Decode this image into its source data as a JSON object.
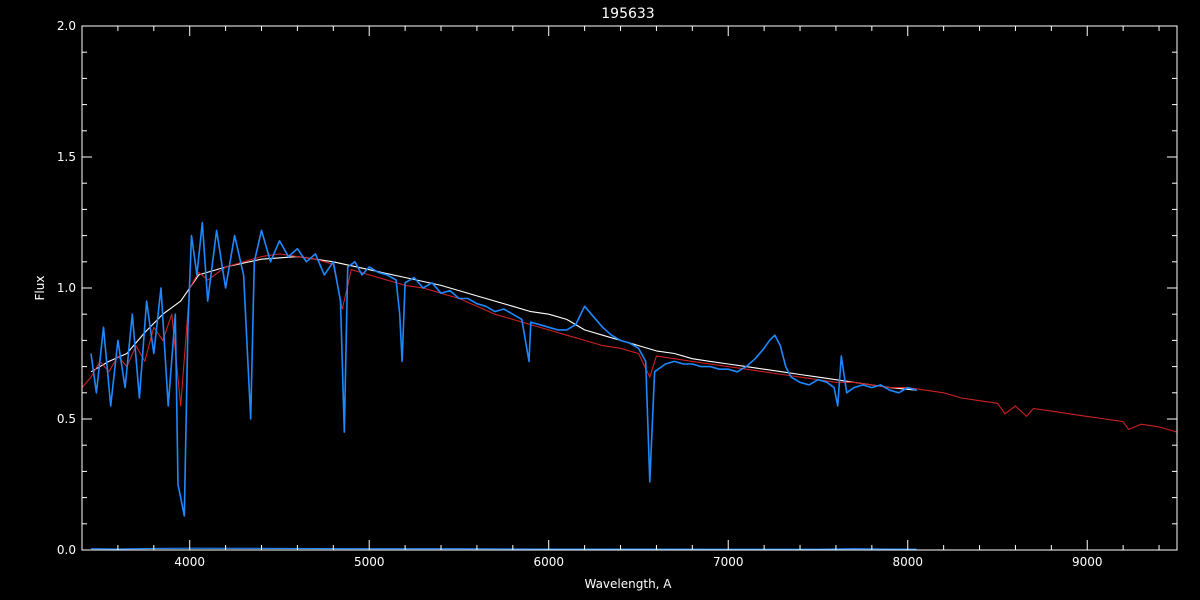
{
  "chart_data": {
    "type": "line",
    "title": "195633",
    "xlabel": "Wavelength, A",
    "ylabel": "Flux",
    "xlim": [
      3400,
      9500
    ],
    "ylim": [
      0,
      2.0
    ],
    "xticks": [
      4000,
      5000,
      6000,
      7000,
      8000,
      9000
    ],
    "xtick_labels": [
      "4000",
      "5000",
      "6000",
      "7000",
      "8000",
      "9000"
    ],
    "yticks": [
      0,
      0.5,
      1.0,
      1.5,
      2.0
    ],
    "ytick_labels": [
      "0.0",
      "0.5",
      "1.0",
      "1.5",
      "2.0"
    ],
    "grid": false,
    "background": "#000000",
    "series": [
      {
        "color": "#ffffff",
        "x": [
          3450,
          3550,
          3650,
          3750,
          3850,
          3950,
          4050,
          4200,
          4400,
          4600,
          4800,
          5000,
          5200,
          5400,
          5600,
          5800,
          5900,
          6000,
          6100,
          6200,
          6300,
          6400,
          6500,
          6600,
          6700,
          6800,
          6900,
          7000,
          7100,
          7200,
          7300,
          7400,
          7500,
          7600,
          7700,
          7800,
          7900,
          8050
        ],
        "y": [
          0.68,
          0.72,
          0.75,
          0.83,
          0.9,
          0.95,
          1.05,
          1.08,
          1.11,
          1.12,
          1.1,
          1.07,
          1.04,
          1.01,
          0.97,
          0.93,
          0.91,
          0.9,
          0.88,
          0.84,
          0.82,
          0.8,
          0.78,
          0.76,
          0.75,
          0.73,
          0.72,
          0.71,
          0.7,
          0.69,
          0.68,
          0.67,
          0.66,
          0.65,
          0.64,
          0.63,
          0.62,
          0.61
        ]
      },
      {
        "color": "#cc2222",
        "x": [
          3400,
          3450,
          3500,
          3550,
          3600,
          3650,
          3700,
          3750,
          3800,
          3850,
          3900,
          3950,
          4000,
          4050,
          4100,
          4200,
          4300,
          4400,
          4500,
          4600,
          4700,
          4800,
          4850,
          4900,
          5000,
          5100,
          5200,
          5300,
          5400,
          5500,
          5600,
          5700,
          5800,
          5900,
          6000,
          6100,
          6200,
          6300,
          6400,
          6500,
          6563,
          6600,
          6700,
          6800,
          6900,
          7000,
          7100,
          7200,
          7300,
          7400,
          7500,
          7600,
          7700,
          7800,
          7900,
          8000,
          8100,
          8200,
          8300,
          8400,
          8500,
          8542,
          8600,
          8662,
          8700,
          8800,
          8900,
          9000,
          9100,
          9200,
          9230,
          9300,
          9400,
          9500
        ],
        "y": [
          0.62,
          0.66,
          0.72,
          0.68,
          0.74,
          0.7,
          0.78,
          0.72,
          0.85,
          0.8,
          0.9,
          0.55,
          1.0,
          1.06,
          1.03,
          1.08,
          1.1,
          1.12,
          1.13,
          1.12,
          1.11,
          1.09,
          0.92,
          1.07,
          1.05,
          1.03,
          1.01,
          1.0,
          0.98,
          0.96,
          0.93,
          0.9,
          0.88,
          0.86,
          0.84,
          0.82,
          0.8,
          0.78,
          0.77,
          0.75,
          0.66,
          0.74,
          0.73,
          0.72,
          0.71,
          0.7,
          0.69,
          0.68,
          0.67,
          0.66,
          0.65,
          0.64,
          0.64,
          0.63,
          0.62,
          0.62,
          0.61,
          0.6,
          0.58,
          0.57,
          0.56,
          0.52,
          0.55,
          0.51,
          0.54,
          0.53,
          0.52,
          0.51,
          0.5,
          0.49,
          0.46,
          0.48,
          0.47,
          0.45
        ]
      },
      {
        "color": "#1e88ff",
        "x": [
          3450,
          3480,
          3520,
          3560,
          3600,
          3640,
          3680,
          3720,
          3760,
          3800,
          3840,
          3880,
          3920,
          3935,
          3950,
          3970,
          3990,
          4010,
          4040,
          4070,
          4100,
          4150,
          4200,
          4250,
          4300,
          4340,
          4360,
          4400,
          4450,
          4500,
          4550,
          4600,
          4650,
          4700,
          4750,
          4800,
          4840,
          4861,
          4880,
          4920,
          4960,
          5000,
          5050,
          5100,
          5150,
          5170,
          5183,
          5200,
          5250,
          5300,
          5350,
          5400,
          5450,
          5500,
          5550,
          5600,
          5650,
          5700,
          5750,
          5800,
          5850,
          5890,
          5900,
          5950,
          6000,
          6050,
          6100,
          6150,
          6200,
          6250,
          6300,
          6350,
          6400,
          6450,
          6500,
          6540,
          6563,
          6590,
          6650,
          6700,
          6750,
          6800,
          6850,
          6900,
          6950,
          7000,
          7050,
          7100,
          7150,
          7200,
          7230,
          7260,
          7290,
          7320,
          7350,
          7400,
          7450,
          7500,
          7550,
          7590,
          7610,
          7630,
          7660,
          7700,
          7750,
          7800,
          7850,
          7900,
          7950,
          8000,
          8050
        ],
        "y": [
          0.75,
          0.6,
          0.85,
          0.55,
          0.8,
          0.62,
          0.9,
          0.58,
          0.95,
          0.75,
          1.0,
          0.55,
          0.9,
          0.25,
          0.2,
          0.13,
          0.85,
          1.2,
          1.05,
          1.25,
          0.95,
          1.22,
          1.0,
          1.2,
          1.05,
          0.5,
          1.1,
          1.22,
          1.1,
          1.18,
          1.12,
          1.15,
          1.1,
          1.13,
          1.05,
          1.1,
          0.95,
          0.45,
          1.08,
          1.1,
          1.05,
          1.08,
          1.06,
          1.05,
          1.03,
          0.9,
          0.72,
          1.02,
          1.04,
          1.0,
          1.02,
          0.98,
          0.99,
          0.96,
          0.96,
          0.94,
          0.93,
          0.91,
          0.92,
          0.9,
          0.88,
          0.72,
          0.87,
          0.86,
          0.85,
          0.84,
          0.84,
          0.86,
          0.93,
          0.89,
          0.85,
          0.82,
          0.8,
          0.79,
          0.77,
          0.72,
          0.26,
          0.68,
          0.71,
          0.72,
          0.71,
          0.71,
          0.7,
          0.7,
          0.69,
          0.69,
          0.68,
          0.7,
          0.73,
          0.77,
          0.8,
          0.82,
          0.78,
          0.7,
          0.66,
          0.64,
          0.63,
          0.65,
          0.64,
          0.62,
          0.55,
          0.74,
          0.6,
          0.62,
          0.63,
          0.62,
          0.63,
          0.61,
          0.6,
          0.62,
          0.61
        ]
      },
      {
        "color": "#1e88ff",
        "x": [
          3450,
          3600,
          3800,
          4000,
          4500,
          5000,
          5500,
          6000,
          6500,
          7000,
          7500,
          7700,
          7900,
          8050
        ],
        "y": [
          0.005,
          0.004,
          0.006,
          0.007,
          0.006,
          0.005,
          0.005,
          0.004,
          0.004,
          0.003,
          0.003,
          0.005,
          0.004,
          0.003
        ]
      }
    ]
  }
}
